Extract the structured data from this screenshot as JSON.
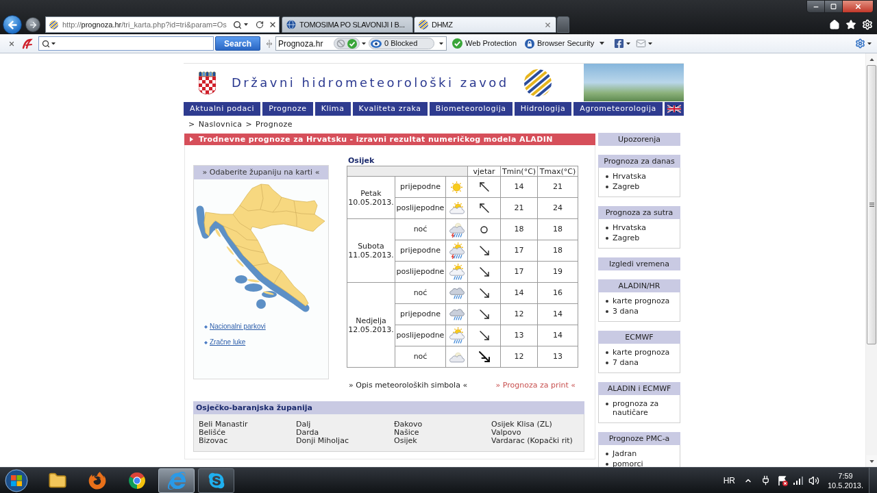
{
  "browser": {
    "address": {
      "scheme": "http://",
      "domain": "prognoza.hr",
      "path": "/tri_karta.php?id=tri&param=Os"
    },
    "tabs": [
      {
        "label": "TOMOSIMA PO SLAVONIJI I B...",
        "selected": false
      },
      {
        "label": "DHMZ",
        "selected": true
      }
    ]
  },
  "toolbar": {
    "search_button": "Search",
    "site_select": "Prognoza.hr",
    "blocked": "0 Blocked",
    "web_protection": "Web Protection",
    "browser_security": "Browser Security"
  },
  "site": {
    "title": "Državni hidrometeorološki zavod",
    "nav": [
      "Aktualni podaci",
      "Prognoze",
      "Klima",
      "Kvaliteta zraka",
      "Biometeorologija",
      "Hidrologija",
      "Agrometeorologija"
    ],
    "breadcrumb": [
      {
        "separator": ">",
        "label": "Naslovnica"
      },
      {
        "separator": ">",
        "label": "Prognoze"
      }
    ],
    "banner": "Trodnevne prognoze za Hrvatsku - izravni rezultat numeričkog modela ALADIN"
  },
  "map_panel": {
    "title": "» Odaberite županiju na karti «",
    "links": [
      "Nacionalni parkovi",
      "Zračne luke"
    ]
  },
  "forecast": {
    "city": "Osijek",
    "columns": [
      "vjetar",
      "Tmin(°C)",
      "Tmax(°C)"
    ],
    "days": [
      {
        "day": "Petak",
        "date": "10.05.2013.",
        "periods": [
          {
            "period": "prijepodne",
            "weather": {
              "kind": "sun"
            },
            "wind": {
              "kind": "nw"
            },
            "tmin": "14",
            "tmax": "21"
          },
          {
            "period": "poslijepodne",
            "weather": {
              "kind": "sun-cloud"
            },
            "wind": {
              "kind": "nw"
            },
            "tmin": "21",
            "tmax": "24"
          }
        ]
      },
      {
        "day": "Subota",
        "date": "11.05.2013.",
        "periods": [
          {
            "period": "noć",
            "weather": {
              "kind": "storm-night"
            },
            "wind": {
              "kind": "calm"
            },
            "tmin": "18",
            "tmax": "18"
          },
          {
            "period": "prijepodne",
            "weather": {
              "kind": "storm"
            },
            "wind": {
              "kind": "se"
            },
            "tmin": "17",
            "tmax": "18"
          },
          {
            "period": "poslijepodne",
            "weather": {
              "kind": "sun-rain"
            },
            "wind": {
              "kind": "se"
            },
            "tmin": "17",
            "tmax": "19"
          }
        ]
      },
      {
        "day": "Nedjelja",
        "date": "12.05.2013.",
        "periods": [
          {
            "period": "noć",
            "weather": {
              "kind": "rain"
            },
            "wind": {
              "kind": "se"
            },
            "tmin": "14",
            "tmax": "16"
          },
          {
            "period": "prijepodne",
            "weather": {
              "kind": "rain"
            },
            "wind": {
              "kind": "se"
            },
            "tmin": "12",
            "tmax": "14"
          },
          {
            "period": "poslijepodne",
            "weather": {
              "kind": "sun-rain"
            },
            "wind": {
              "kind": "se"
            },
            "tmin": "13",
            "tmax": "14"
          },
          {
            "period": "noć",
            "weather": {
              "kind": "cloudy-night"
            },
            "wind": {
              "kind": "se-strong"
            },
            "tmin": "12",
            "tmax": "13"
          }
        ]
      }
    ]
  },
  "footer_links": {
    "symbols": "» Opis meteoroloških simbola «",
    "print": "» Prognoza za print «"
  },
  "county": {
    "title": "Osječko-baranjska županija",
    "columns": [
      [
        "Beli Manastir",
        "Belišće",
        "Bizovac"
      ],
      [
        "Dalj",
        "Darda",
        "Donji Miholjac"
      ],
      [
        "Đakovo",
        "Našice",
        "Osijek"
      ],
      [
        "Osijek Klisa (ZL)",
        "Valpovo",
        "Vardarac (Kopački rit)"
      ]
    ]
  },
  "sidebar": [
    {
      "title": "Upozorenja"
    },
    {
      "title": "Prognoza za danas",
      "items": [
        "Hrvatska",
        "Zagreb"
      ]
    },
    {
      "title": "Prognoza za sutra",
      "items": [
        "Hrvatska",
        "Zagreb"
      ]
    },
    {
      "title": "Izgledi vremena"
    },
    {
      "title": "ALADIN/HR",
      "items": [
        "karte prognoza",
        "3 dana"
      ]
    },
    {
      "title": "ECMWF",
      "items": [
        "karte prognoza",
        "7 dana"
      ]
    },
    {
      "title": "ALADIN i ECMWF",
      "items": [
        "prognoza za nautičare"
      ]
    },
    {
      "title": "Prognoze PMC-a",
      "items": [
        "Jadran",
        "pomorci"
      ]
    }
  ],
  "taskbar": {
    "apps": [
      {
        "kind": "folder",
        "running": false,
        "selected": false
      },
      {
        "kind": "firefox",
        "running": false,
        "selected": false
      },
      {
        "kind": "chrome",
        "running": false,
        "selected": false
      },
      {
        "kind": "ie",
        "running": true,
        "selected": true
      },
      {
        "kind": "skype",
        "running": true,
        "selected": false
      }
    ],
    "language": "HR",
    "time": "7:59",
    "date": "10.5.2013."
  }
}
